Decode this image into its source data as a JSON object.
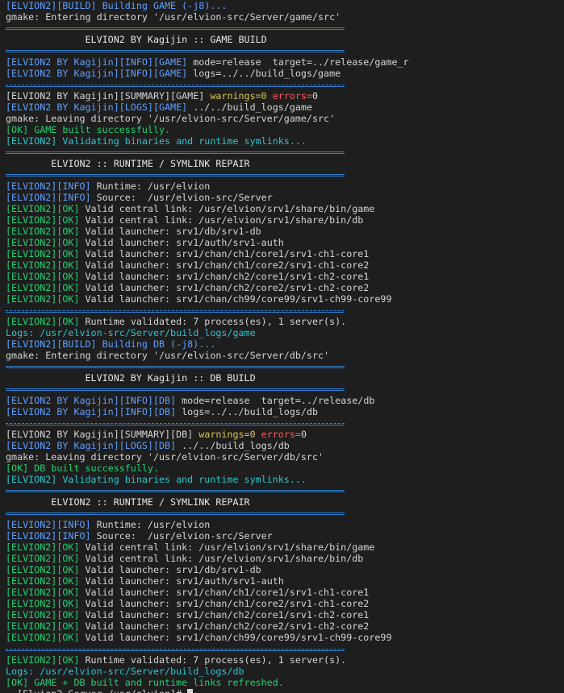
{
  "terminal": {
    "lines": [
      {
        "kind": "text",
        "segs": [
          {
            "c": "blue",
            "t": "[ELVION2][BUILD] Building GAME (-j8)..."
          }
        ]
      },
      {
        "kind": "text",
        "segs": [
          {
            "c": "white",
            "t": "gmake: Entering directory '/usr/elvion-src/Server/game/src'"
          }
        ]
      },
      {
        "kind": "sep"
      },
      {
        "kind": "text",
        "segs": [
          {
            "c": "title",
            "t": "              ELVION2 BY Kagijin :: GAME BUILD"
          }
        ]
      },
      {
        "kind": "sep"
      },
      {
        "kind": "text",
        "segs": [
          {
            "c": "blue",
            "t": "[ELVION2 BY Kagijin][INFO][GAME]"
          },
          {
            "c": "white",
            "t": " mode=release  target=../release/game_r"
          }
        ]
      },
      {
        "kind": "text",
        "segs": [
          {
            "c": "blue",
            "t": "[ELVION2 BY Kagijin][INFO][GAME]"
          },
          {
            "c": "white",
            "t": " logs=../../build_logs/game"
          }
        ]
      },
      {
        "kind": "septhin"
      },
      {
        "kind": "text",
        "segs": [
          {
            "c": "white",
            "t": "[ELVION2 BY Kagijin][SUMMARY][GAME] "
          },
          {
            "c": "yellow",
            "t": "warnings=0"
          },
          {
            "c": "white",
            "t": " "
          },
          {
            "c": "red",
            "t": "errors="
          },
          {
            "c": "white",
            "t": "0"
          }
        ]
      },
      {
        "kind": "text",
        "segs": [
          {
            "c": "blue",
            "t": "[ELVION2 BY Kagijin][LOGS][GAME]"
          },
          {
            "c": "white",
            "t": " ../../build_logs/game"
          }
        ]
      },
      {
        "kind": "text",
        "segs": [
          {
            "c": "white",
            "t": "gmake: Leaving directory '/usr/elvion-src/Server/game/src'"
          }
        ]
      },
      {
        "kind": "text",
        "segs": [
          {
            "c": "green",
            "t": "[OK] GAME built successfully."
          }
        ]
      },
      {
        "kind": "text",
        "segs": [
          {
            "c": "cyan",
            "t": "[ELVION2] Validating binaries and runtime symlinks..."
          }
        ]
      },
      {
        "kind": "sep"
      },
      {
        "kind": "text",
        "segs": [
          {
            "c": "title",
            "t": "        ELVION2 :: RUNTIME / SYMLINK REPAIR"
          }
        ]
      },
      {
        "kind": "sep"
      },
      {
        "kind": "text",
        "segs": [
          {
            "c": "blue",
            "t": "[ELVION2][INFO]"
          },
          {
            "c": "white",
            "t": " Runtime: /usr/elvion"
          }
        ]
      },
      {
        "kind": "text",
        "segs": [
          {
            "c": "blue",
            "t": "[ELVION2][INFO]"
          },
          {
            "c": "white",
            "t": " Source:  /usr/elvion-src/Server"
          }
        ]
      },
      {
        "kind": "text",
        "segs": [
          {
            "c": "green",
            "t": "[ELVION2][OK]"
          },
          {
            "c": "white",
            "t": " Valid central link: /usr/elvion/srv1/share/bin/game"
          }
        ]
      },
      {
        "kind": "text",
        "segs": [
          {
            "c": "green",
            "t": "[ELVION2][OK]"
          },
          {
            "c": "white",
            "t": " Valid central link: /usr/elvion/srv1/share/bin/db"
          }
        ]
      },
      {
        "kind": "text",
        "segs": [
          {
            "c": "green",
            "t": "[ELVION2][OK]"
          },
          {
            "c": "white",
            "t": " Valid launcher: srv1/db/srv1-db"
          }
        ]
      },
      {
        "kind": "text",
        "segs": [
          {
            "c": "green",
            "t": "[ELVION2][OK]"
          },
          {
            "c": "white",
            "t": " Valid launcher: srv1/auth/srv1-auth"
          }
        ]
      },
      {
        "kind": "text",
        "segs": [
          {
            "c": "green",
            "t": "[ELVION2][OK]"
          },
          {
            "c": "white",
            "t": " Valid launcher: srv1/chan/ch1/core1/srv1-ch1-core1"
          }
        ]
      },
      {
        "kind": "text",
        "segs": [
          {
            "c": "green",
            "t": "[ELVION2][OK]"
          },
          {
            "c": "white",
            "t": " Valid launcher: srv1/chan/ch1/core2/srv1-ch1-core2"
          }
        ]
      },
      {
        "kind": "text",
        "segs": [
          {
            "c": "green",
            "t": "[ELVION2][OK]"
          },
          {
            "c": "white",
            "t": " Valid launcher: srv1/chan/ch2/core1/srv1-ch2-core1"
          }
        ]
      },
      {
        "kind": "text",
        "segs": [
          {
            "c": "green",
            "t": "[ELVION2][OK]"
          },
          {
            "c": "white",
            "t": " Valid launcher: srv1/chan/ch2/core2/srv1-ch2-core2"
          }
        ]
      },
      {
        "kind": "text",
        "segs": [
          {
            "c": "green",
            "t": "[ELVION2][OK]"
          },
          {
            "c": "white",
            "t": " Valid launcher: srv1/chan/ch99/core99/srv1-ch99-core99"
          }
        ]
      },
      {
        "kind": "septhin"
      },
      {
        "kind": "text",
        "segs": [
          {
            "c": "green",
            "t": "[ELVION2][OK]"
          },
          {
            "c": "white",
            "t": " Runtime validated: 7 process(es), 1 server(s)."
          }
        ]
      },
      {
        "kind": "text",
        "segs": [
          {
            "c": "cyan",
            "t": "Logs: /usr/elvion-src/Server/build_logs/game"
          }
        ]
      },
      {
        "kind": "text",
        "segs": [
          {
            "c": "blue",
            "t": "[ELVION2][BUILD] Building DB (-j8)..."
          }
        ]
      },
      {
        "kind": "text",
        "segs": [
          {
            "c": "white",
            "t": "gmake: Entering directory '/usr/elvion-src/Server/db/src'"
          }
        ]
      },
      {
        "kind": "sep"
      },
      {
        "kind": "text",
        "segs": [
          {
            "c": "title",
            "t": "              ELVION2 BY Kagijin :: DB BUILD"
          }
        ]
      },
      {
        "kind": "sep"
      },
      {
        "kind": "text",
        "segs": [
          {
            "c": "blue",
            "t": "[ELVION2 BY Kagijin][INFO][DB]"
          },
          {
            "c": "white",
            "t": " mode=release  target=../release/db"
          }
        ]
      },
      {
        "kind": "text",
        "segs": [
          {
            "c": "blue",
            "t": "[ELVION2 BY Kagijin][INFO][DB]"
          },
          {
            "c": "white",
            "t": " logs=../../build_logs/db"
          }
        ]
      },
      {
        "kind": "septhin"
      },
      {
        "kind": "text",
        "segs": [
          {
            "c": "white",
            "t": "[ELVION2 BY Kagijin][SUMMARY][DB] "
          },
          {
            "c": "yellow",
            "t": "warnings=0"
          },
          {
            "c": "white",
            "t": " "
          },
          {
            "c": "red",
            "t": "errors="
          },
          {
            "c": "white",
            "t": "0"
          }
        ]
      },
      {
        "kind": "text",
        "segs": [
          {
            "c": "blue",
            "t": "[ELVION2 BY Kagijin][LOGS][DB]"
          },
          {
            "c": "white",
            "t": " ../../build_logs/db"
          }
        ]
      },
      {
        "kind": "text",
        "segs": [
          {
            "c": "white",
            "t": "gmake: Leaving directory '/usr/elvion-src/Server/db/src'"
          }
        ]
      },
      {
        "kind": "text",
        "segs": [
          {
            "c": "green",
            "t": "[OK] DB built successfully."
          }
        ]
      },
      {
        "kind": "text",
        "segs": [
          {
            "c": "cyan",
            "t": "[ELVION2] Validating binaries and runtime symlinks..."
          }
        ]
      },
      {
        "kind": "sep"
      },
      {
        "kind": "text",
        "segs": [
          {
            "c": "title",
            "t": "        ELVION2 :: RUNTIME / SYMLINK REPAIR"
          }
        ]
      },
      {
        "kind": "sep"
      },
      {
        "kind": "text",
        "segs": [
          {
            "c": "blue",
            "t": "[ELVION2][INFO]"
          },
          {
            "c": "white",
            "t": " Runtime: /usr/elvion"
          }
        ]
      },
      {
        "kind": "text",
        "segs": [
          {
            "c": "blue",
            "t": "[ELVION2][INFO]"
          },
          {
            "c": "white",
            "t": " Source:  /usr/elvion-src/Server"
          }
        ]
      },
      {
        "kind": "text",
        "segs": [
          {
            "c": "green",
            "t": "[ELVION2][OK]"
          },
          {
            "c": "white",
            "t": " Valid central link: /usr/elvion/srv1/share/bin/game"
          }
        ]
      },
      {
        "kind": "text",
        "segs": [
          {
            "c": "green",
            "t": "[ELVION2][OK]"
          },
          {
            "c": "white",
            "t": " Valid central link: /usr/elvion/srv1/share/bin/db"
          }
        ]
      },
      {
        "kind": "text",
        "segs": [
          {
            "c": "green",
            "t": "[ELVION2][OK]"
          },
          {
            "c": "white",
            "t": " Valid launcher: srv1/db/srv1-db"
          }
        ]
      },
      {
        "kind": "text",
        "segs": [
          {
            "c": "green",
            "t": "[ELVION2][OK]"
          },
          {
            "c": "white",
            "t": " Valid launcher: srv1/auth/srv1-auth"
          }
        ]
      },
      {
        "kind": "text",
        "segs": [
          {
            "c": "green",
            "t": "[ELVION2][OK]"
          },
          {
            "c": "white",
            "t": " Valid launcher: srv1/chan/ch1/core1/srv1-ch1-core1"
          }
        ]
      },
      {
        "kind": "text",
        "segs": [
          {
            "c": "green",
            "t": "[ELVION2][OK]"
          },
          {
            "c": "white",
            "t": " Valid launcher: srv1/chan/ch1/core2/srv1-ch1-core2"
          }
        ]
      },
      {
        "kind": "text",
        "segs": [
          {
            "c": "green",
            "t": "[ELVION2][OK]"
          },
          {
            "c": "white",
            "t": " Valid launcher: srv1/chan/ch2/core1/srv1-ch2-core1"
          }
        ]
      },
      {
        "kind": "text",
        "segs": [
          {
            "c": "green",
            "t": "[ELVION2][OK]"
          },
          {
            "c": "white",
            "t": " Valid launcher: srv1/chan/ch2/core2/srv1-ch2-core2"
          }
        ]
      },
      {
        "kind": "text",
        "segs": [
          {
            "c": "green",
            "t": "[ELVION2][OK]"
          },
          {
            "c": "white",
            "t": " Valid launcher: srv1/chan/ch99/core99/srv1-ch99-core99"
          }
        ]
      },
      {
        "kind": "septhin"
      },
      {
        "kind": "text",
        "segs": [
          {
            "c": "green",
            "t": "[ELVION2][OK]"
          },
          {
            "c": "white",
            "t": " Runtime validated: 7 process(es), 1 server(s)."
          }
        ]
      },
      {
        "kind": "text",
        "segs": [
          {
            "c": "cyan",
            "t": "Logs: /usr/elvion-src/Server/build_logs/db"
          }
        ]
      },
      {
        "kind": "text",
        "segs": [
          {
            "c": "green",
            "t": "[OK] GAME + DB built and runtime links refreshed."
          }
        ]
      },
      {
        "kind": "prompt",
        "segs": [
          {
            "c": "white",
            "t": "  [Elvion2 Server /usr/elvion]# "
          }
        ]
      }
    ]
  },
  "colors": {
    "background": "#1e1e1e",
    "blue": "#5f9fff",
    "green": "#1fd16f",
    "cyan": "#29c6d0",
    "yellow": "#d7c64b",
    "red": "#ff5a5a",
    "text": "#d4d4d4",
    "separator": "#2f7fd0"
  }
}
